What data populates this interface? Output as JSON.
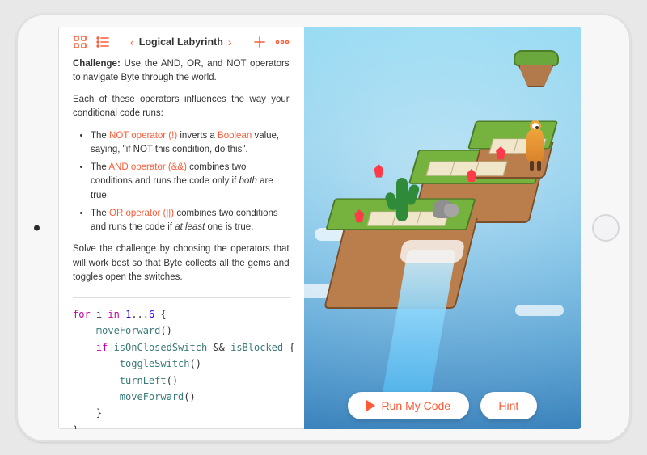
{
  "toolbar": {
    "title": "Logical Labyrinth"
  },
  "instructions": {
    "challenge_label": "Challenge:",
    "challenge_text": " Use the AND, OR, and NOT operators to navigate Byte through the world.",
    "intro": "Each of these operators influences the way your conditional code runs:",
    "bullets": {
      "not": {
        "pre": "The ",
        "kw": "NOT operator (!)",
        "mid": " inverts a ",
        "kw2": "Boolean",
        "post": " value, saying, \"if NOT this condition, do this\"."
      },
      "and": {
        "pre": "The ",
        "kw": "AND operator (&&)",
        "mid": " combines two conditions and runs the code only if ",
        "em": "both",
        "post": " are true."
      },
      "or": {
        "pre": "The ",
        "kw": "OR operator (||)",
        "mid": " combines two conditions and runs the code if ",
        "em": "at least",
        "post": " one is true."
      }
    },
    "outro": "Solve the challenge by choosing the operators that will work best so that Byte collects all the gems and toggles open the switches."
  },
  "code": {
    "for": "for",
    "var": "i",
    "in": "in",
    "range_lo": "1",
    "range_hi": "6",
    "dots": "...",
    "moveForward": "moveForward",
    "if": "if",
    "cond_a": "isOnClosedSwitch",
    "and": "&&",
    "cond_b": "isBlocked",
    "toggleSwitch": "toggleSwitch",
    "turnLeft": "turnLeft"
  },
  "buttons": {
    "run": "Run My Code",
    "hint": "Hint"
  },
  "icons": {
    "grid": "grid-icon",
    "list": "list-icon",
    "prev": "chevron-left-icon",
    "next": "chevron-right-icon",
    "add": "plus-icon",
    "more": "more-icon"
  }
}
